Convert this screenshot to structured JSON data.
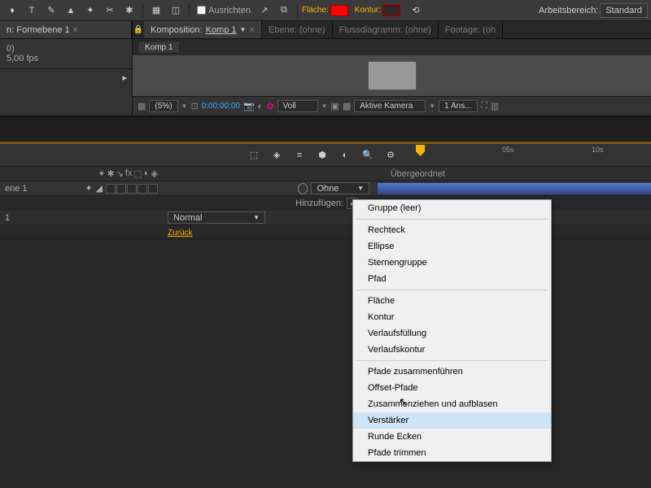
{
  "toolbar": {
    "align_label": "Ausrichten",
    "fill_label": "Fläche:",
    "stroke_label": "Kontur:",
    "workspace_label": "Arbeitsbereich:",
    "workspace_value": "Standard",
    "fill_color": "#ff0000",
    "stroke_color": "#880000"
  },
  "project_panel": {
    "tab": "n: Formebene 1",
    "line1": "0)",
    "line2": "5,00 fps"
  },
  "comp_panel": {
    "tab_prefix": "Komposition:",
    "tab_name": "Komp 1",
    "tabs": [
      {
        "label": "Ebene: (ohne)"
      },
      {
        "label": "Flussdiagramm: (ohne)"
      },
      {
        "label": "Footage: (oh"
      }
    ],
    "subtab": "Komp 1"
  },
  "viewer_controls": {
    "zoom": "(5%)",
    "timecode": "0:00:00:00",
    "quality": "Voll",
    "view": "Aktive Kamera",
    "views_count": "1 Ans..."
  },
  "timeline": {
    "parent_header": "Übergeordnet",
    "ruler_ticks": [
      "05s",
      "10s"
    ],
    "parent_none": "Ohne",
    "layer_label": "ene 1",
    "layer_num": "1",
    "blend_mode": "Normal",
    "add_label": "Hinzufügen:",
    "back_link": "Zurück"
  },
  "context_menu": {
    "groups": [
      [
        "Gruppe (leer)"
      ],
      [
        "Rechteck",
        "Ellipse",
        "Sternengruppe",
        "Pfad"
      ],
      [
        "Fläche",
        "Kontur",
        "Verlaufsfüllung",
        "Verlaufskontur"
      ],
      [
        "Pfade zusammenführen",
        "Offset-Pfade",
        "Zusammenziehen und aufblasen",
        "Verstärker",
        "Runde Ecken",
        "Pfade trimmen"
      ]
    ],
    "highlighted": "Verstärker"
  }
}
